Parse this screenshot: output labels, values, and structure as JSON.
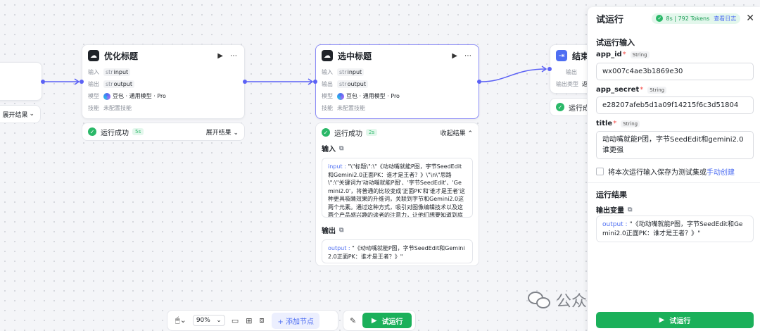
{
  "left_stub": {
    "toggle_label": "展开结果"
  },
  "node_optimize": {
    "title": "优化标题",
    "run_icon": "play-icon",
    "more_icon": "more-icon",
    "rows": {
      "input_label": "输入",
      "input_type": "str",
      "input_name": "input",
      "output_label": "输出",
      "output_type": "str",
      "output_name": "output",
      "model_label": "模型",
      "model_value": "豆包 · 通用模型 · Pro",
      "skill_label": "技能",
      "skill_value": "未配置技能"
    },
    "status": {
      "text": "运行成功",
      "time": "5s",
      "toggle": "展开结果"
    }
  },
  "node_select": {
    "title": "选中标题",
    "rows": {
      "input_label": "输入",
      "input_type": "str",
      "input_name": "input",
      "output_label": "输出",
      "output_type": "str",
      "output_name": "output",
      "model_label": "模型",
      "model_value": "豆包 · 通用模型 · Pro",
      "skill_label": "技能",
      "skill_value": "未配置技能"
    },
    "status": {
      "text": "运行成功",
      "time": "2s",
      "toggle": "收起结果"
    },
    "result": {
      "input_title": "输入",
      "input_key": "input",
      "input_value": "\"\\\"标题\\\":\\\"《动动嘴就能P图，字节SeedEdit和Gemini2.0正面PK：谁才是王者？》\\\"\\n\\\"思路\\\":\\\"关键词为'动动嘴就能P图'、'字节SeedEdit'、'Gemini2.0'，将普通的比较变成'正面PK'和'谁才是王者'这种更具吸睛效果的升维词，关联到字节和Gemini2.0这两个元素。通过这种方式，吸引对图像编辑技术以及这两个产品感兴趣的读者的注意力，让他们想要知道到底哪个产品更强。\\\"\"",
      "output_title": "输出",
      "output_key": "output",
      "output_value": "\"《动动嘴就能P图，字节SeedEdit和Gemini2.0正面PK：谁才是王者？》\""
    }
  },
  "node_end": {
    "title": "结束",
    "output_label": "输出",
    "output_type_label": "输出类型",
    "output_type_value": "返",
    "status_text": "运行成"
  },
  "panel": {
    "title": "试运行",
    "stats": "8s | 792 Tokens",
    "log_link": "查看日志",
    "input_section": "试运行输入",
    "fields": [
      {
        "name": "app_id",
        "type": "String",
        "value": "wx007c4ae3b1869e30"
      },
      {
        "name": "app_secret",
        "type": "String",
        "value": "e28207afeb5d1a09f14215f6c3d51804"
      },
      {
        "name": "title",
        "type": "String",
        "value": "动动嘴就能P团，字节SeedEdit和gemini2.0谁更强"
      }
    ],
    "save_text": "将本次运行输入保存为测试集或",
    "save_link": "手动创建",
    "result_section": "运行结果",
    "output_var_title": "输出变量",
    "output_key": "output",
    "output_value": "\"《动动嘴就能P图，字节SeedEdit和Gemini2.0正面PK：谁才是王者？》\"",
    "run_button": "试运行"
  },
  "toolbar": {
    "zoom": "90%",
    "add_node": "添加节点",
    "run_button": "试运行"
  },
  "watermark": {
    "text": "公众号 · AI进修士"
  },
  "colors": {
    "accent": "#4e6ef2",
    "success": "#1bb05a",
    "selected_border": "#8b8cf6"
  }
}
